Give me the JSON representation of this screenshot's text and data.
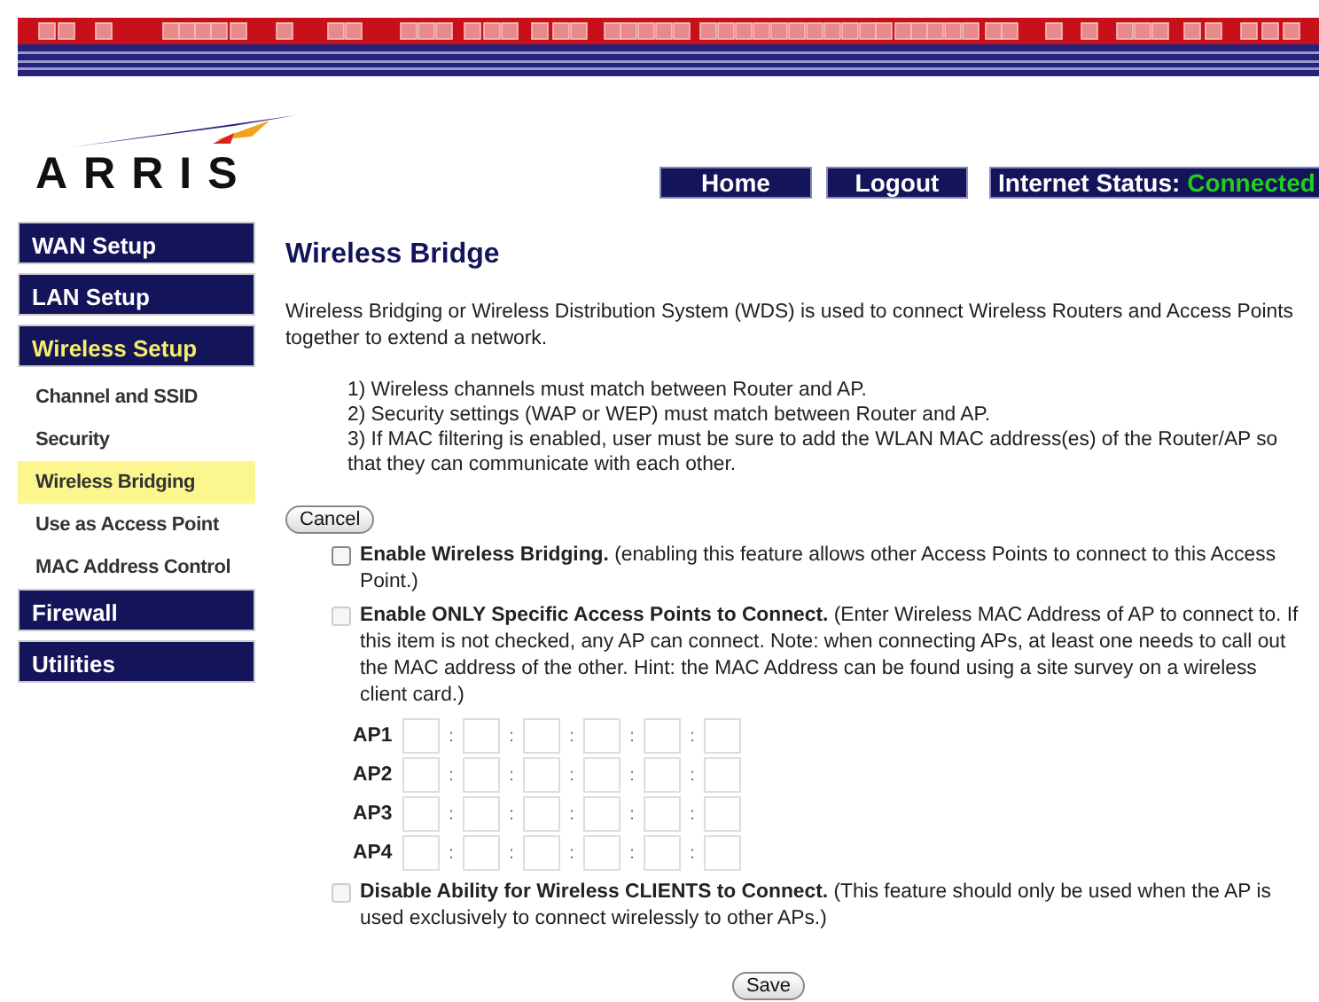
{
  "header": {
    "logo": "ARRIS",
    "nav_buttons": [
      "Home",
      "Logout"
    ],
    "status_label": "Internet Status:",
    "status_value": "Connected"
  },
  "sidebar": {
    "items": [
      {
        "label": "WAN Setup",
        "kind": "section",
        "selected": false
      },
      {
        "label": "LAN Setup",
        "kind": "section",
        "selected": false
      },
      {
        "label": "Wireless Setup",
        "kind": "section",
        "selected": true
      },
      {
        "label": "Channel and SSID",
        "kind": "sub",
        "selected": false
      },
      {
        "label": "Security",
        "kind": "sub",
        "selected": false
      },
      {
        "label": "Wireless Bridging",
        "kind": "sub",
        "selected": true
      },
      {
        "label": "Use as Access Point",
        "kind": "sub",
        "selected": false
      },
      {
        "label": "MAC Address Control",
        "kind": "sub",
        "selected": false
      },
      {
        "label": "Firewall",
        "kind": "section",
        "selected": false
      },
      {
        "label": "Utilities",
        "kind": "section",
        "selected": false
      }
    ]
  },
  "content": {
    "title": "Wireless Bridge",
    "intro": "Wireless Bridging or Wireless Distribution System (WDS) is used to connect Wireless Routers and Access Points together to extend a network.",
    "rules": [
      "1) Wireless channels must match between Router and AP.",
      "2) Security settings (WAP or WEP) must match between Router and AP.",
      "3) If MAC filtering is enabled, user must be sure to add the WLAN MAC address(es) of the Router/AP so that they can communicate with each other."
    ],
    "cancel_button": "Cancel",
    "options": [
      {
        "text": "**Enable Wireless Bridging.** (enabling this feature allows other Access Points to connect to this Access Point.)",
        "checked": false,
        "disabled": false
      },
      {
        "text": "**Enable ONLY Specific Access Points to Connect.** (Enter Wireless MAC Address of AP to connect to. If this item is not checked, any AP can connect. Note: when connecting APs, at least one needs to call out the MAC address of the other. Hint: the MAC Address can be found using a site survey on a wireless client card.)",
        "checked": false,
        "disabled": true
      }
    ],
    "ap_rows": [
      {
        "label": "AP1",
        "separators": [
          ":",
          ":",
          ":",
          ":",
          ":"
        ]
      },
      {
        "label": "AP2",
        "separators": [
          ":",
          ":",
          ":",
          ":",
          ":"
        ]
      },
      {
        "label": "AP3",
        "separators": [
          ":",
          ":",
          ":",
          ":",
          ":"
        ]
      },
      {
        "label": "AP4",
        "separators": [
          ":",
          ":",
          ":",
          ":",
          ":"
        ]
      }
    ],
    "final_option": {
      "text": "**Disable Ability for Wireless CLIENTS to Connect.** (This feature should only be used when the AP is used exclusively to connect wirelessly to other APs.)",
      "checked": false,
      "disabled": true
    },
    "save_button": "Save"
  }
}
